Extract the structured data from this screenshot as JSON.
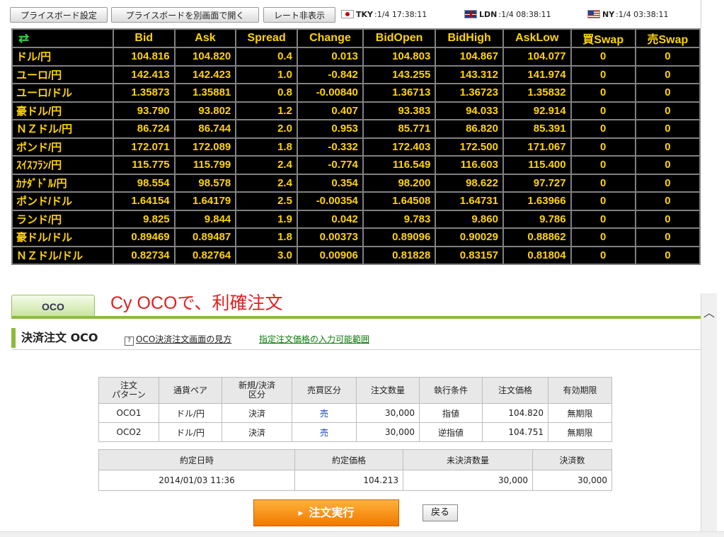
{
  "toolbar": {
    "settings_label": "プライスボード設定",
    "popout_label": "プライスボードを別画面で開く",
    "hide_rate_label": "レート非表示"
  },
  "clocks": [
    {
      "city": "TKY",
      "time": ":1/4  17:38:11",
      "flag": "japan-flag-icon"
    },
    {
      "city": "LDN",
      "time": ":1/4  08:38:11",
      "flag": "uk-flag-icon"
    },
    {
      "city": "NY",
      "time": ":1/4  03:38:11",
      "flag": "us-flag-icon"
    }
  ],
  "rates": {
    "refresh_icon": "refresh-icon",
    "columns": [
      "Bid",
      "Ask",
      "Spread",
      "Change",
      "BidOpen",
      "BidHigh",
      "AskLow",
      "買Swap",
      "売Swap"
    ],
    "rows": [
      {
        "pair": "ドル/円",
        "bid": "104.816",
        "ask": "104.820",
        "spread": "0.4",
        "change": "0.013",
        "bidopen": "104.803",
        "bidhigh": "104.867",
        "asklow": "104.077",
        "buyswap": "0",
        "sellswap": "0"
      },
      {
        "pair": "ユーロ/円",
        "bid": "142.413",
        "ask": "142.423",
        "spread": "1.0",
        "change": "-0.842",
        "bidopen": "143.255",
        "bidhigh": "143.312",
        "asklow": "141.974",
        "buyswap": "0",
        "sellswap": "0"
      },
      {
        "pair": "ユーロ/ドル",
        "bid": "1.35873",
        "ask": "1.35881",
        "spread": "0.8",
        "change": "-0.00840",
        "bidopen": "1.36713",
        "bidhigh": "1.36723",
        "asklow": "1.35832",
        "buyswap": "0",
        "sellswap": "0"
      },
      {
        "pair": "豪ドル/円",
        "bid": "93.790",
        "ask": "93.802",
        "spread": "1.2",
        "change": "0.407",
        "bidopen": "93.383",
        "bidhigh": "94.033",
        "asklow": "92.914",
        "buyswap": "0",
        "sellswap": "0"
      },
      {
        "pair": "ＮＺドル/円",
        "bid": "86.724",
        "ask": "86.744",
        "spread": "2.0",
        "change": "0.953",
        "bidopen": "85.771",
        "bidhigh": "86.820",
        "asklow": "85.391",
        "buyswap": "0",
        "sellswap": "0"
      },
      {
        "pair": "ポンド/円",
        "bid": "172.071",
        "ask": "172.089",
        "spread": "1.8",
        "change": "-0.332",
        "bidopen": "172.403",
        "bidhigh": "172.500",
        "asklow": "171.067",
        "buyswap": "0",
        "sellswap": "0"
      },
      {
        "pair": "ｽｲｽﾌﾗﾝ/円",
        "bid": "115.775",
        "ask": "115.799",
        "spread": "2.4",
        "change": "-0.774",
        "bidopen": "116.549",
        "bidhigh": "116.603",
        "asklow": "115.400",
        "buyswap": "0",
        "sellswap": "0"
      },
      {
        "pair": "ｶﾅﾀﾞﾄﾞﾙ/円",
        "bid": "98.554",
        "ask": "98.578",
        "spread": "2.4",
        "change": "0.354",
        "bidopen": "98.200",
        "bidhigh": "98.622",
        "asklow": "97.727",
        "buyswap": "0",
        "sellswap": "0"
      },
      {
        "pair": "ポンド/ドル",
        "bid": "1.64154",
        "ask": "1.64179",
        "spread": "2.5",
        "change": "-0.00354",
        "bidopen": "1.64508",
        "bidhigh": "1.64731",
        "asklow": "1.63966",
        "buyswap": "0",
        "sellswap": "0"
      },
      {
        "pair": "ランド/円",
        "bid": "9.825",
        "ask": "9.844",
        "spread": "1.9",
        "change": "0.042",
        "bidopen": "9.783",
        "bidhigh": "9.860",
        "asklow": "9.786",
        "buyswap": "0",
        "sellswap": "0"
      },
      {
        "pair": "豪ドル/ドル",
        "bid": "0.89469",
        "ask": "0.89487",
        "spread": "1.8",
        "change": "0.00373",
        "bidopen": "0.89096",
        "bidhigh": "0.90029",
        "asklow": "0.88862",
        "buyswap": "0",
        "sellswap": "0"
      },
      {
        "pair": "ＮＺドル/ドル",
        "bid": "0.82734",
        "ask": "0.82764",
        "spread": "3.0",
        "change": "0.00906",
        "bidopen": "0.81828",
        "bidhigh": "0.83157",
        "asklow": "0.81804",
        "buyswap": "0",
        "sellswap": "0"
      }
    ]
  },
  "oco_tab": {
    "label": "OCO"
  },
  "annotation": "Cy OCOで、利確注文",
  "section": {
    "title": "決済注文 OCO",
    "help_link": "OCO決済注文画面の見方",
    "help_icon": "question-icon",
    "range_link": "指定注文価格の入力可能範囲"
  },
  "orders": {
    "headers": [
      "注文\nパターン",
      "通貨ペア",
      "新規/決済\n区分",
      "売買区分",
      "注文数量",
      "執行条件",
      "注文価格",
      "有効期限"
    ],
    "rows": [
      {
        "pattern": "OCO1",
        "pair": "ドル/円",
        "type": "決済",
        "side": "売",
        "qty": "30,000",
        "condition": "指値",
        "price": "104.820",
        "expiry": "無期限"
      },
      {
        "pattern": "OCO2",
        "pair": "ドル/円",
        "type": "決済",
        "side": "売",
        "qty": "30,000",
        "condition": "逆指値",
        "price": "104.751",
        "expiry": "無期限"
      }
    ]
  },
  "fill": {
    "headers": [
      "約定日時",
      "約定価格",
      "未決済数量",
      "決済数"
    ],
    "row": {
      "datetime": "2014/01/03 11:36",
      "price": "104.213",
      "open_qty": "30,000",
      "settle_qty": "30,000"
    }
  },
  "actions": {
    "execute_label": "注文実行",
    "back_label": "戻る"
  },
  "colors": {
    "board_bg": "#000000",
    "board_text": "#ffd400",
    "tab_green": "#8dbb3a",
    "execute_orange": "#f58a0a",
    "annotation_red": "#e02020",
    "side_blue": "#1040c0"
  }
}
